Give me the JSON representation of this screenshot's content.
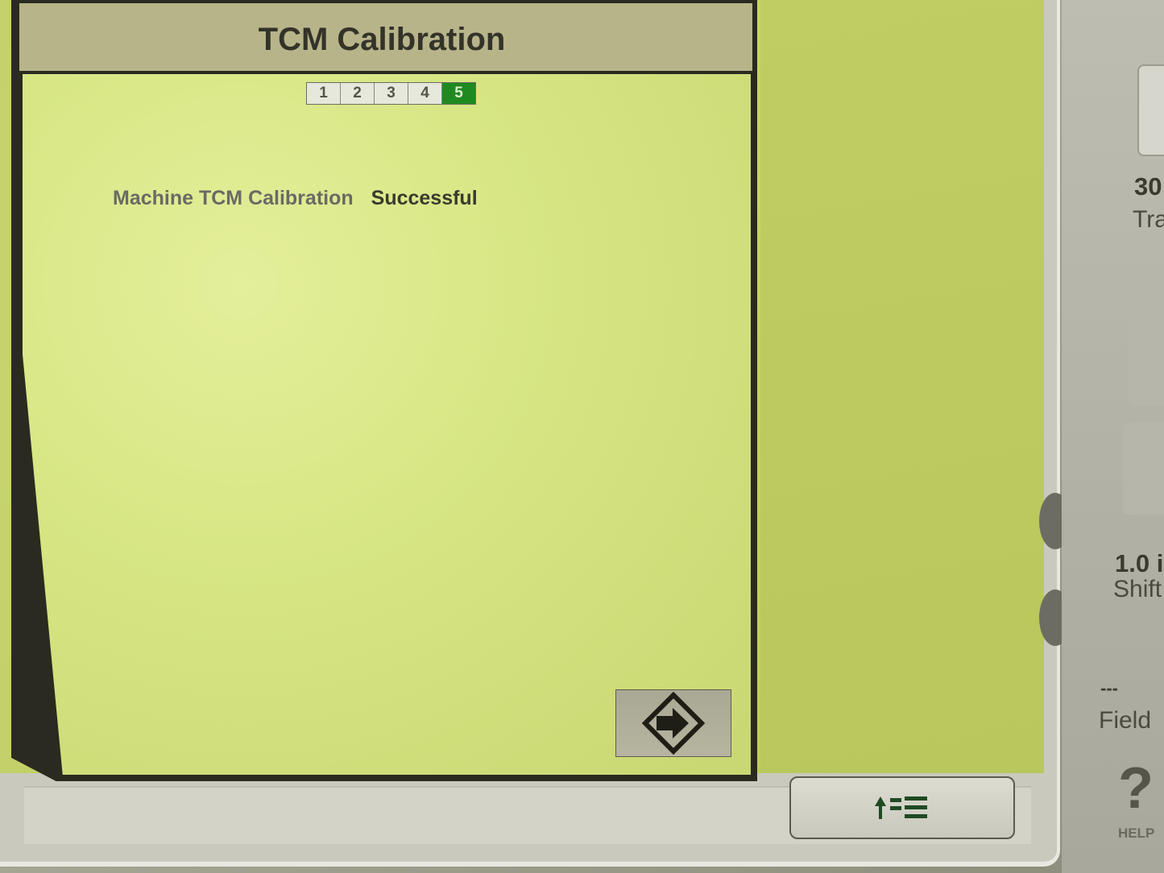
{
  "dialog": {
    "title": "TCM Calibration",
    "steps": [
      "1",
      "2",
      "3",
      "4",
      "5"
    ],
    "active_step": 5,
    "status_label": "Machine TCM Calibration",
    "status_value": "Successful",
    "next_icon": "arrow-right-diamond-icon"
  },
  "bottom_bar": {
    "menu_icon": "up-arrow-list-icon"
  },
  "side_panel": {
    "item1_value": "30",
    "item1_label": "Tra",
    "item2_value": "1.0 i",
    "item2_label": "Shift",
    "item3_value": "---",
    "item3_label": "Field",
    "item4_glyph": "?",
    "help_label": "HELP"
  },
  "colors": {
    "active_step": "#1f8a1f",
    "workspace": "#c7d46c",
    "header": "#b8b48a"
  }
}
